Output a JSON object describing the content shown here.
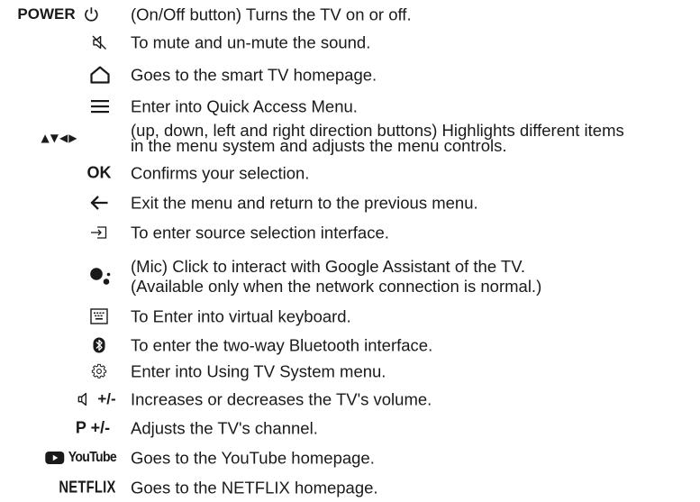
{
  "rows": [
    {
      "key": "POWER",
      "desc": [
        "(On/Off button) Turns the TV on or off."
      ]
    },
    {
      "desc": [
        "To mute and un-mute the sound."
      ]
    },
    {
      "desc": [
        "Goes to the smart TV homepage."
      ]
    },
    {
      "desc": [
        "Enter into Quick Access Menu."
      ]
    },
    {
      "key": "▲▼◀▶",
      "desc": [
        "(up, down, left and right direction buttons) Highlights different items",
        "in the menu system and adjusts the menu controls."
      ]
    },
    {
      "key": "OK",
      "desc": [
        "Confirms your selection."
      ]
    },
    {
      "desc": [
        "Exit the menu and return to the previous menu."
      ]
    },
    {
      "desc": [
        "To enter source selection interface."
      ]
    },
    {
      "desc": [
        "(Mic) Click to interact with Google Assistant of the TV.",
        "(Available only when the network connection is normal.)"
      ]
    },
    {
      "desc": [
        "To Enter into virtual keyboard."
      ]
    },
    {
      "desc": [
        "To enter the two-way Bluetooth interface."
      ]
    },
    {
      "desc": [
        "Enter into Using TV System menu."
      ]
    },
    {
      "key": "+/-",
      "desc": [
        "Increases or decreases the TV's volume."
      ]
    },
    {
      "key": "P +/-",
      "desc": [
        "Adjusts the TV's channel."
      ]
    },
    {
      "key": "YouTube",
      "desc": [
        "Goes to the YouTube homepage."
      ]
    },
    {
      "key": "NETFLIX",
      "desc": [
        "Goes to the NETFLIX homepage."
      ]
    }
  ]
}
